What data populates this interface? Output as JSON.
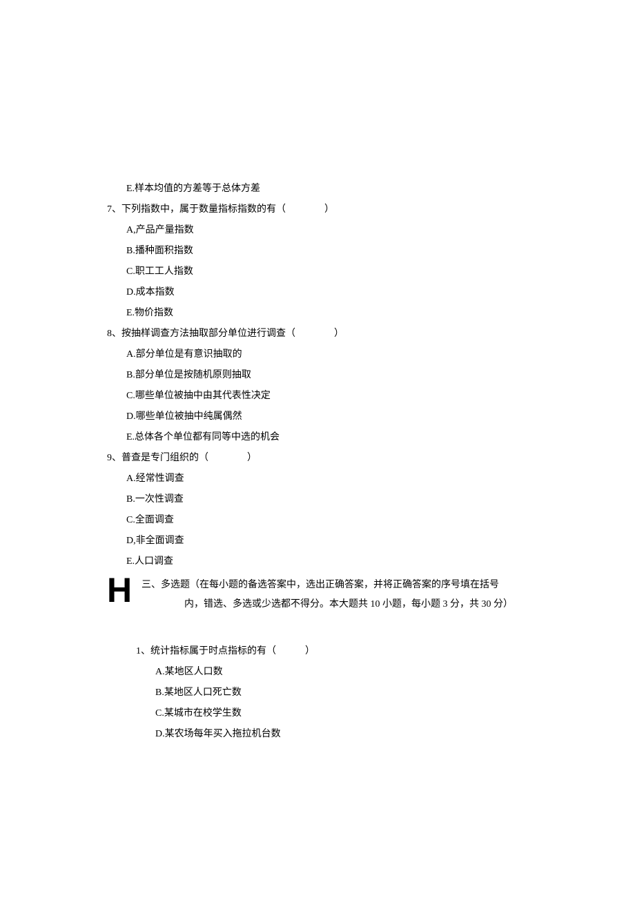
{
  "orphan_option_e": "E.样本均值的方差等于总体方差",
  "q7": {
    "stem": "7、下列指数中，属于数量指标指数的有（　　　　）",
    "a": "A,产品产量指数",
    "b": "B.播种面积指数",
    "c": "C.职工工人指数",
    "d": "D.成本指数",
    "e": "E.物价指数"
  },
  "q8": {
    "stem": "8、按抽样调查方法抽取部分单位进行调查（　　　　）",
    "a": "A.部分单位是有意识抽取的",
    "b": "B.部分单位是按随机原则抽取",
    "c": "C.哪些单位被抽中由其代表性决定",
    "d": "D.哪些单位被抽中纯属偶然",
    "e": "E.总体各个单位都有同等中选的机会"
  },
  "q9": {
    "stem": "9、普查是专门组织的（　　　　）",
    "a": "A.经常性调查",
    "b": "B.一次性调查",
    "c": "C.全面调查",
    "d": "D,非全面调查",
    "e": "E.人口调查"
  },
  "section3": {
    "h_symbol": "H",
    "line1": "三、多选题（在每小题的备选答案中，选出正确答案，并将正确答案的序号填在括号",
    "line2": "内，错选、多选或少选都不得分。本大题共 10 小题，每小题 3 分，共 30 分）"
  },
  "s3_q1": {
    "stem": "1、统计指标属于时点指标的有（　　　）",
    "a": "A.某地区人口数",
    "b": "B.某地区人口死亡数",
    "c": "C.某城市在校学生数",
    "d": "D.某农场每年买入拖拉机台数"
  }
}
